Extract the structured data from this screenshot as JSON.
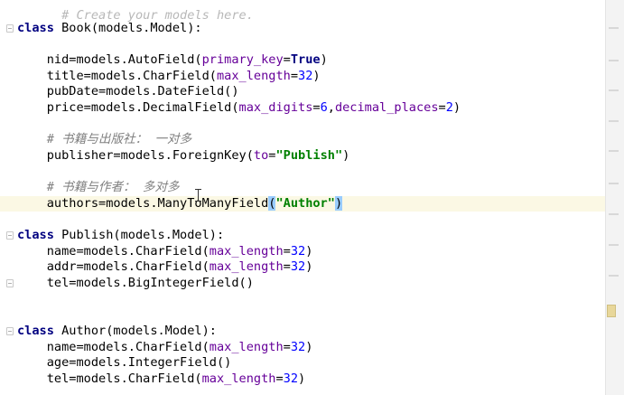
{
  "editor": {
    "top_line": "# Create your models here.",
    "lines": {
      "book_class": {
        "kw": "class",
        "rest": " Book(models.Model):"
      },
      "book_nid": {
        "a": "    nid=models.AutoField(",
        "k": "primary_key",
        "eq": "=",
        "b": "True",
        "c": ")"
      },
      "book_title": {
        "a": "    title=models.CharField(",
        "k": "max_length",
        "eq": "=",
        "n": "32",
        "c": ")"
      },
      "book_pubdate": {
        "a": "    pubDate=models.DateField()"
      },
      "book_price": {
        "a": "    price=models.DecimalField(",
        "k1": "max_digits",
        "eq1": "=",
        "n1": "6",
        "sep": ",",
        "k2": "decimal_places",
        "eq2": "=",
        "n2": "2",
        "c": ")"
      },
      "comment_publish": "    # 书籍与出版社： 一对多",
      "book_publisher": {
        "a": "    publisher=models.ForeignKey(",
        "k": "to",
        "eq": "=",
        "s": "\"Publish\"",
        "c": ")"
      },
      "comment_author": "    # 书籍与作者： 多对多",
      "book_authors": {
        "a": "    authors=models.ManyToManyField",
        "o": "(",
        "s": "\"Author\"",
        "c": ")"
      },
      "publish_class": {
        "kw": "class",
        "rest": " Publish(models.Model):"
      },
      "publish_name": {
        "a": "    name=models.CharField(",
        "k": "max_length",
        "eq": "=",
        "n": "32",
        "c": ")"
      },
      "publish_addr": {
        "a": "    addr=models.CharField(",
        "k": "max_length",
        "eq": "=",
        "n": "32",
        "c": ")"
      },
      "publish_tel": {
        "a": "    tel=models.BigIntegerField()"
      },
      "author_class": {
        "kw": "class",
        "rest": " Author(models.Model):"
      },
      "author_name": {
        "a": "    name=models.CharField(",
        "k": "max_length",
        "eq": "=",
        "n": "32",
        "c": ")"
      },
      "author_age": {
        "a": "    age=models.IntegerField()"
      },
      "author_tel": {
        "a": "    tel=models.CharField(",
        "k": "max_length",
        "eq": "=",
        "n": "32",
        "c": ")"
      }
    }
  },
  "colors": {
    "keyword": "#000080",
    "kwarg": "#660099",
    "number": "#0000ff",
    "string": "#008000",
    "comment": "#808080",
    "current_line": "#fbf8e4",
    "brace_match": "#99ccff"
  }
}
